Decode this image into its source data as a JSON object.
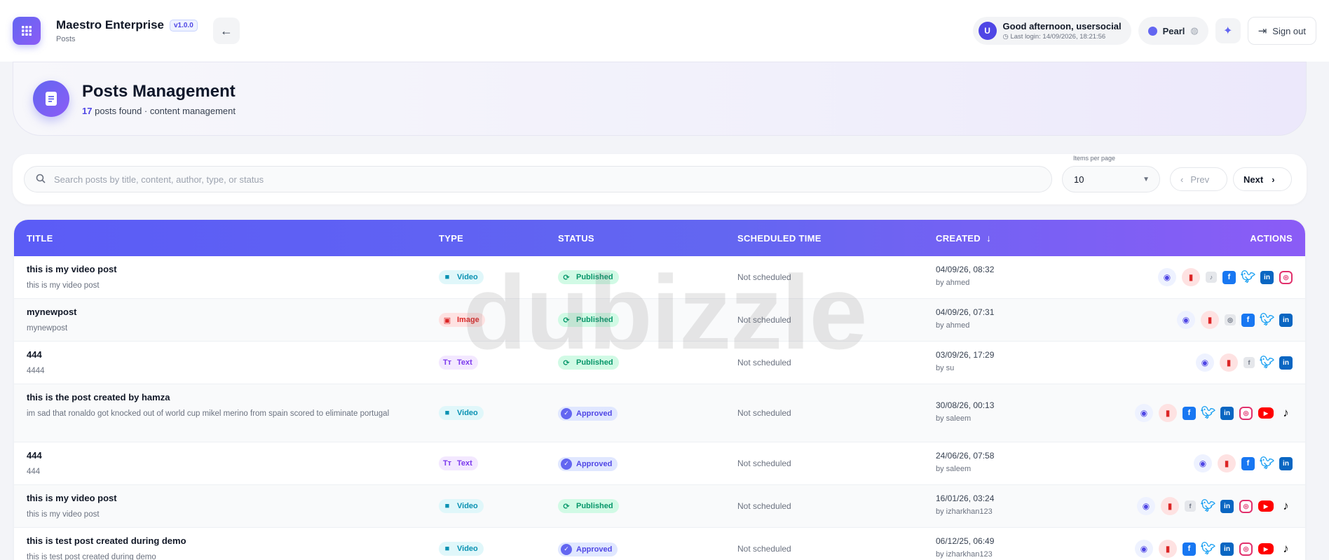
{
  "app": {
    "name": "Maestro Enterprise",
    "version": "v1.0.0",
    "breadcrumb": "Posts"
  },
  "user": {
    "avatar_initial": "U",
    "greeting": "Good afternoon, usersocial",
    "last_login": "Last login: 14/09/2026, 18:21:56",
    "assistant_name": "Pearl",
    "sign_out_label": "Sign out"
  },
  "page": {
    "title": "Posts Management",
    "count": "17",
    "subtitle_rest": "posts found · content management"
  },
  "toolbar": {
    "search_placeholder": "Search posts by title, content, author, type, or status",
    "items_per_page_label": "Items per page",
    "items_per_page_value": "10",
    "prev_label": "Prev",
    "next_label": "Next"
  },
  "table": {
    "headers": {
      "title": "TITLE",
      "type": "TYPE",
      "status": "STATUS",
      "scheduled": "SCHEDULED TIME",
      "created": "CREATED",
      "actions": "ACTIONS"
    },
    "rows": [
      {
        "title": "this is my video post",
        "content": "this is my video post",
        "type": "Video",
        "status": "Published",
        "scheduled": "Not scheduled",
        "created": "04/09/26, 08:32",
        "by": "by ahmed"
      },
      {
        "title": "mynewpost",
        "content": "mynewpost",
        "type": "Image",
        "status": "Published",
        "scheduled": "Not scheduled",
        "created": "04/09/26, 07:31",
        "by": "by ahmed"
      },
      {
        "title": "444",
        "content": "4444",
        "type": "Text",
        "status": "Published",
        "scheduled": "Not scheduled",
        "created": "03/09/26, 17:29",
        "by": "by su"
      },
      {
        "title": "this is the post created by hamza",
        "content": "im sad that ronaldo got knocked out of world cup mikel merino from spain scored to eliminate portugal",
        "type": "Video",
        "status": "Approved",
        "scheduled": "Not scheduled",
        "created": "30/08/26, 00:13",
        "by": "by saleem"
      },
      {
        "title": "444",
        "content": "444",
        "type": "Text",
        "status": "Approved",
        "scheduled": "Not scheduled",
        "created": "24/06/26, 07:58",
        "by": "by saleem"
      },
      {
        "title": "this is my video post",
        "content": "this is my video post",
        "type": "Video",
        "status": "Published",
        "scheduled": "Not scheduled",
        "created": "16/01/26, 03:24",
        "by": "by izharkhan123"
      },
      {
        "title": "this is test post created during demo",
        "content": "this is test post created during demo",
        "type": "Video",
        "status": "Approved",
        "scheduled": "Not scheduled",
        "created": "06/12/25, 06:49",
        "by": "by izharkhan123"
      }
    ]
  },
  "watermark": "dubizzle",
  "colors": {
    "accent": "#6366f1",
    "accent_2": "#8b5cf6",
    "published": "#059669",
    "approved": "#4f46e5",
    "danger": "#dc2626"
  }
}
